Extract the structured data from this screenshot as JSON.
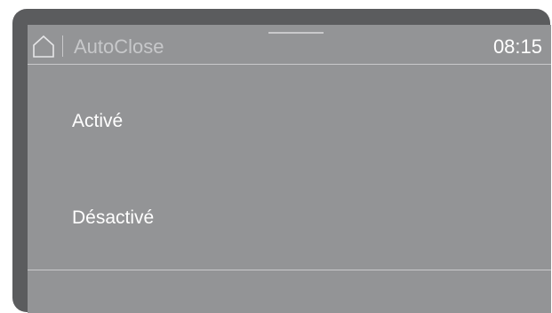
{
  "header": {
    "home_icon": "home-outline-icon",
    "title": "AutoClose",
    "time": "08:15"
  },
  "options": [
    {
      "label": "Activé"
    },
    {
      "label": "Désactivé"
    }
  ],
  "colors": {
    "bezel": "#5b5c5e",
    "screen": "#939496",
    "divider": "#c9c9cb",
    "title_text": "#c7c8ca",
    "text": "#ffffff"
  }
}
